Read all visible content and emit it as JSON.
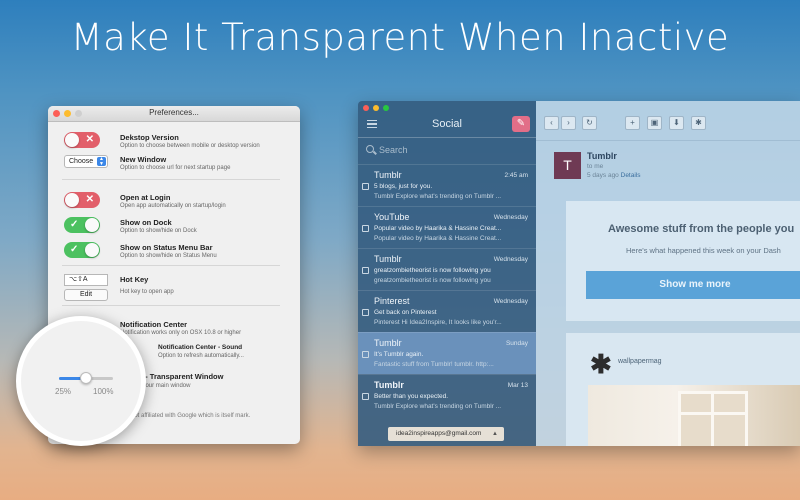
{
  "headline": "Make It Transparent When Inactive",
  "prefs": {
    "title": "Preferences...",
    "rows": [
      {
        "title": "Dekstop Version",
        "sub": "Option to choose between mobile or desktop version",
        "control": "toggle-off"
      },
      {
        "title": "New Window",
        "sub": "Option to choose url for next startup page",
        "control": "choose",
        "choose_label": "Choose"
      },
      {
        "title": "Open at Login",
        "sub": "Open app automatically on startup/login",
        "control": "toggle-off"
      },
      {
        "title": "Show on Dock",
        "sub": "Option to show/hide on Dock",
        "control": "toggle-on"
      },
      {
        "title": "Show on Status Menu Bar",
        "sub": "Option to show/hide on Status Menu",
        "control": "toggle-on"
      },
      {
        "title": "Hot Key",
        "sub": "Hot key to open app",
        "control": "hotkey",
        "hotkey_value": "⌥⇧A",
        "edit_label": "Edit"
      },
      {
        "title": "Notification Center",
        "sub": "Notification works only on OSX 10.8 or higher"
      },
      {
        "title": "Notification Center - Sound",
        "sub": "Option to refresh automatically..."
      },
      {
        "title": "Vis  - Transparent Window",
        "sub": "Tra        your main window"
      }
    ],
    "footer": "p is not affiliated with Google which is itself           mark."
  },
  "magnifier": {
    "min_label": "25%",
    "max_label": "100%",
    "value_fraction": 0.5
  },
  "mail": {
    "list_title": "Social",
    "search_placeholder": "Search",
    "messages": [
      {
        "from": "Tumblr",
        "time": "2:45 am",
        "subject": "5 blogs, just for you.",
        "preview": "Tumblr Explore what's trending on Tumblr ..."
      },
      {
        "from": "YouTube",
        "time": "Wednesday",
        "subject": "Popular video by Haarika & Hassine Creat...",
        "preview": "Popular video by Haarika & Hassine Creat..."
      },
      {
        "from": "Tumblr",
        "time": "Wednesday",
        "subject": "greatzombietheorist is now following you",
        "preview": "greatzombietheorist is now following you"
      },
      {
        "from": "Pinterest",
        "time": "Wednesday",
        "subject": "Get back on Pinterest",
        "preview": "Pinterest Hi Idea2Inspire, It looks like you'r..."
      },
      {
        "from": "Tumblr",
        "time": "Sunday",
        "subject": "It's Tumblr again.",
        "preview": "Fantastic stuff from Tumblr! tumblr. http:..."
      },
      {
        "from": "Tumblr",
        "time": "Mar 13",
        "subject": "Better than you expected.",
        "preview": "Tumblr Explore what's trending on Tumblr ..."
      }
    ],
    "account": "idea2inspireapps@gmail.com",
    "reader": {
      "avatar_letter": "T",
      "sender": "Tumblr",
      "to": "to me",
      "date": "5 days ago",
      "details": "Details",
      "card_heading": "Awesome stuff from the people you",
      "card_sub": "Here's what happened this week on your Dash",
      "button": "Show me more",
      "post_author": "wallpapermag"
    }
  }
}
